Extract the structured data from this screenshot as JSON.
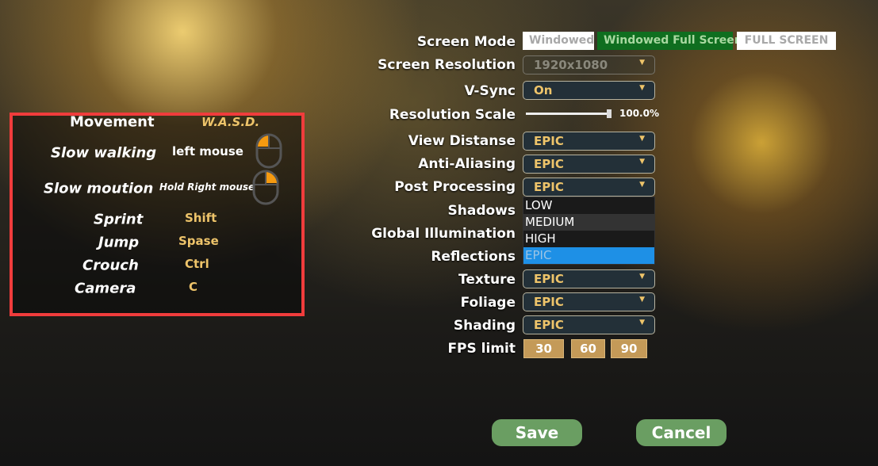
{
  "controls": {
    "rows": [
      {
        "label": "Movement",
        "value": "W.A.S.D."
      },
      {
        "label": "Slow walking",
        "value": "left mouse",
        "icon": "mouse-left-icon"
      },
      {
        "label": "Slow moution",
        "value": "Hold Right mouse",
        "icon": "mouse-right-icon"
      },
      {
        "label": "Sprint",
        "value": "Shift"
      },
      {
        "label": "Jump",
        "value": "Spase"
      },
      {
        "label": "Crouch",
        "value": "Ctrl"
      },
      {
        "label": "Camera",
        "value": "C"
      }
    ],
    "highlight_color": "#f03c3c"
  },
  "settings": {
    "screen_mode": {
      "label": "Screen Mode",
      "options": [
        "Windowed",
        "Windowed Full Screen",
        "FULL SCREEN"
      ],
      "selected": "Windowed Full Screen"
    },
    "screen_resolution": {
      "label": "Screen Resolution",
      "value": "1920x1080"
    },
    "vsync": {
      "label": "V-Sync",
      "value": "On"
    },
    "resolution_scale": {
      "label": "Resolution Scale",
      "value": "100.0%",
      "percent": 100
    },
    "view_distance": {
      "label": "View Distanse",
      "value": "EPIC"
    },
    "anti_aliasing": {
      "label": "Anti-Aliasing",
      "value": "EPIC"
    },
    "post_processing": {
      "label": "Post Processing",
      "value": "EPIC",
      "open_options": [
        "LOW",
        "MEDIUM",
        "HIGH",
        "EPIC"
      ],
      "highlighted": "EPIC"
    },
    "shadows": {
      "label": "Shadows"
    },
    "global_illumination": {
      "label": "Global Illumination"
    },
    "reflections": {
      "label": "Reflections"
    },
    "texture": {
      "label": "Texture",
      "value": "EPIC"
    },
    "foliage": {
      "label": "Foliage",
      "value": "EPIC"
    },
    "shading": {
      "label": "Shading",
      "value": "EPIC"
    },
    "fps_limit": {
      "label": "FPS limit",
      "options": [
        "30",
        "60",
        "90"
      ]
    }
  },
  "actions": {
    "save": "Save",
    "cancel": "Cancel"
  },
  "colors": {
    "selected_mode": "#0f6e1f",
    "value_text": "#eec46a",
    "button": "#6a9e62",
    "fps_button": "#c49a58",
    "highlight": "#1e90e6"
  }
}
